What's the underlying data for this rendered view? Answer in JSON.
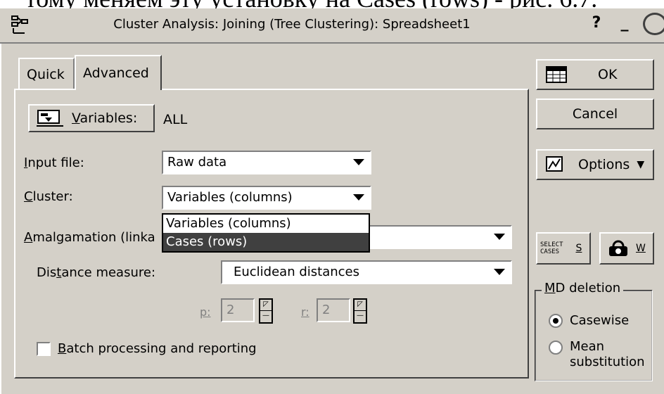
{
  "header_text": "тому меняем эту установку на Cases (rows) - рис. 6.7.",
  "window": {
    "title": "Cluster Analysis: Joining (Tree Clustering): Spreadsheet1",
    "help_label": "?",
    "minimize_label": "_"
  },
  "tabs": [
    {
      "label": "Quick"
    },
    {
      "label": "Advanced"
    }
  ],
  "variables": {
    "button_label": "Variables:",
    "value": "ALL"
  },
  "input_file": {
    "label": "Input file:",
    "value": "Raw data"
  },
  "cluster": {
    "label": "Cluster:",
    "value": "Variables (columns)",
    "options": [
      "Variables (columns)",
      "Cases (rows)"
    ],
    "highlighted_option": "Cases (rows)"
  },
  "amalgamation": {
    "label": "Amalgamation (linka"
  },
  "distance": {
    "label": "Distance measure:",
    "value": "Euclidean distances"
  },
  "params": {
    "p_label": "p:",
    "p_value": "2",
    "r_label": "r:",
    "r_value": "2"
  },
  "batch": {
    "label": "Batch processing and reporting",
    "checked": false
  },
  "side_buttons": {
    "ok": "OK",
    "cancel": "Cancel",
    "options": "Options",
    "select_cases_line1": "SELECT",
    "select_cases_line2": "CASES",
    "select_cases_hotkey": "S",
    "weight_hotkey": "W"
  },
  "md_deletion": {
    "title": "MD deletion",
    "options": [
      {
        "label": "Casewise",
        "selected": true
      },
      {
        "label": "Mean substitution",
        "selected": false
      }
    ]
  },
  "colors": {
    "face": "#d4d0c8",
    "highlight": "#404040"
  }
}
